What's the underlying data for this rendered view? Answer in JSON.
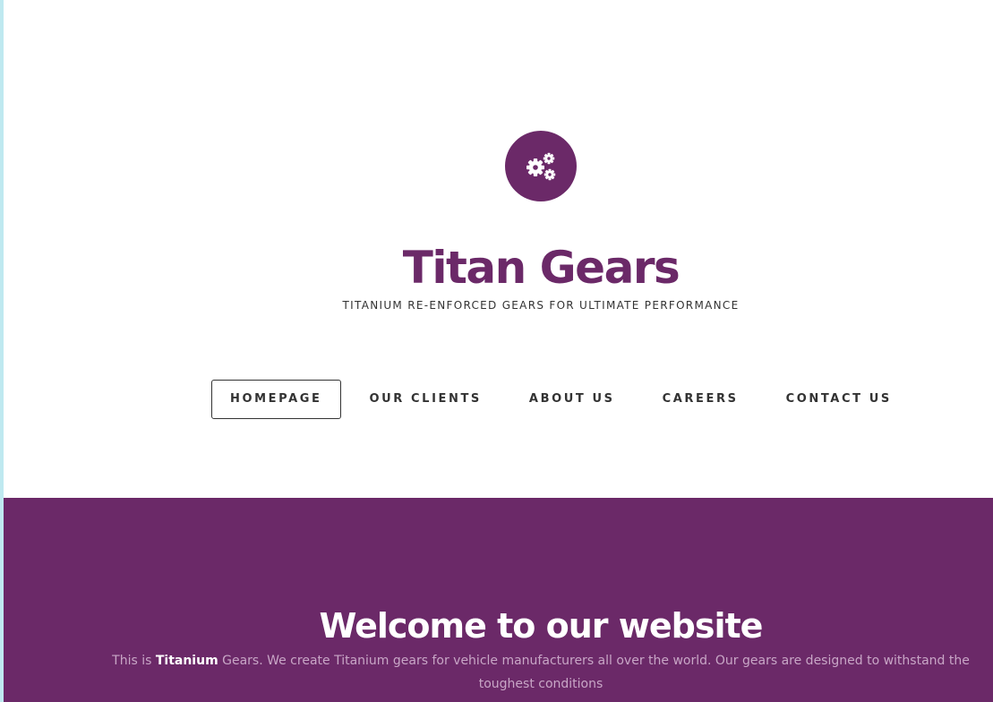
{
  "colors": {
    "brand": "#6b2968",
    "text_dark": "#333333",
    "welcome_text": "#c8a6c6",
    "left_edge": "#bfe9f0"
  },
  "header": {
    "logo_icon": "gears-icon",
    "title": "Titan Gears",
    "tagline": "TITANIUM RE-ENFORCED GEARS FOR ULTIMATE PERFORMANCE"
  },
  "nav": {
    "active": "HOMEPAGE",
    "items": [
      {
        "label": "HOMEPAGE"
      },
      {
        "label": "OUR CLIENTS"
      },
      {
        "label": "ABOUT US"
      },
      {
        "label": "CAREERS"
      },
      {
        "label": "CONTACT US"
      }
    ]
  },
  "welcome": {
    "title": "Welcome to our website",
    "text_prefix": "This is ",
    "text_bold": "Titanium",
    "text_suffix": " Gears. We create Titanium gears for vehicle manufacturers all over the world. Our gears are designed to withstand the toughest conditions"
  }
}
